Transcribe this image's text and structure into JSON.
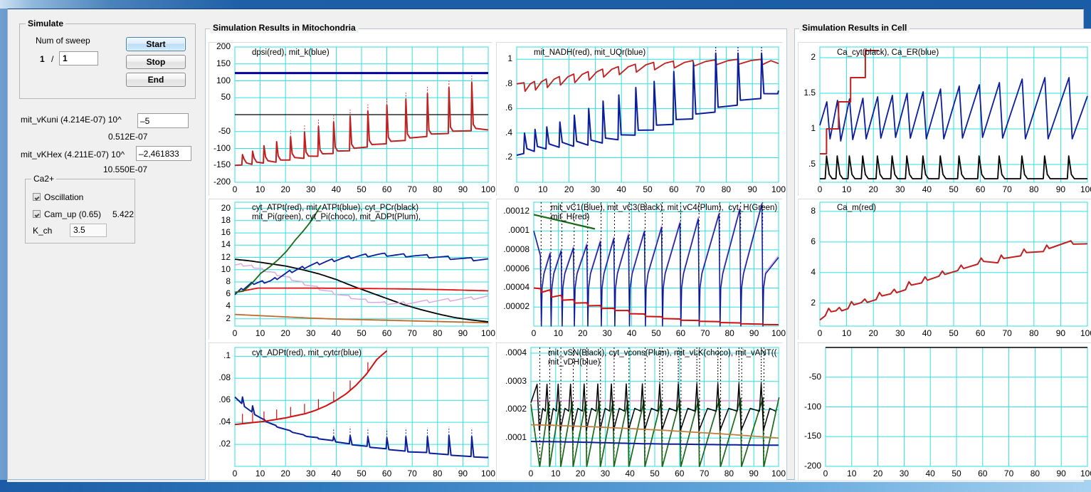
{
  "window": {
    "title": ""
  },
  "simulate": {
    "group_label": "Simulate",
    "sweep_label": "Num of sweep",
    "sweep_current": "1",
    "sweep_separator": "/",
    "sweep_total": "1",
    "start_label": "Start",
    "stop_label": "Stop",
    "end_label": "End"
  },
  "params": {
    "vkuni_label": "mit_vKuni (4.214E-07)  10^",
    "vkuni_exponent": "–5",
    "vkuni_result": "0.512E-07",
    "vkhex_label": "mit_vKHex (4.211E-07)  10^",
    "vkhex_exponent": "–2,461833",
    "vkhex_result": "10.550E-07"
  },
  "ca2plus": {
    "group_label": "Ca2+",
    "oscillation_label": "Oscillation",
    "oscillation_checked": true,
    "camup_label": "Cam_up (0.65)",
    "camup_checked": true,
    "camup_value": "5.422",
    "kch_label": "K_ch",
    "kch_value": "3.5"
  },
  "panels": {
    "mitochondria_title": "Simulation Results in Mitochondria",
    "cell_title": "Simulation Results in Cell"
  },
  "chart_data": [
    {
      "id": "mito-dpsi",
      "type": "line",
      "title": "dpsi(red), mit_k(blue)",
      "legend": "dpsi(red), mit_k(blue)",
      "xlabel": "",
      "ylabel": "",
      "xlim": [
        0,
        100
      ],
      "ylim": [
        -200,
        200
      ],
      "xticks": [
        0,
        10,
        20,
        30,
        40,
        50,
        60,
        70,
        80,
        90,
        100
      ],
      "yticks": [
        200,
        150,
        100,
        50,
        -50,
        -100,
        -150,
        -200
      ],
      "ytick_labels": [
        "200",
        "150",
        "100",
        "50",
        "-50",
        "-100",
        "-150",
        "-200"
      ],
      "grid": true,
      "series": [
        {
          "name": "dpsi",
          "color": "#d02020",
          "description": "sawtooth bursts rising from -150 baseline to -45; spike peaks grow 2 -> 100",
          "baseline": [
            -150,
            -148,
            -143,
            -140,
            -132,
            -128,
            -120,
            -112,
            -105,
            -95,
            -88,
            -80,
            -72,
            -64,
            -58,
            -52,
            -47,
            -45
          ],
          "spike_peaks": [
            -118,
            -108,
            -92,
            -80,
            -66,
            -52,
            -35,
            -22,
            -5,
            10,
            28,
            45,
            62,
            80,
            95
          ],
          "spike_times": [
            3,
            7,
            11.5,
            16.5,
            22,
            27.5,
            33,
            39,
            45.5,
            52.5,
            60,
            67.5,
            76,
            84.5,
            93.5
          ]
        },
        {
          "name": "mit_k",
          "color": "#0000a0",
          "description": "flat horizontal line at 123",
          "constant": 123
        },
        {
          "name": "zero-axis",
          "color": "#000000",
          "constant": 0
        }
      ]
    },
    {
      "id": "mito-nadh",
      "type": "line",
      "title": "mit_NADH(red), mit_UQr(blue)",
      "legend": "mit_NADH(red), mit_UQr(blue)",
      "xlim": [
        0,
        100
      ],
      "ylim": [
        0,
        1.1
      ],
      "xticks": [
        0,
        10,
        20,
        30,
        40,
        50,
        60,
        70,
        80,
        90,
        100
      ],
      "yticks": [
        1,
        0.8,
        0.6,
        0.4,
        0.2
      ],
      "ytick_labels": [
        "1",
        ".8",
        ".6",
        ".4",
        ".2"
      ],
      "grid": true,
      "series": [
        {
          "name": "mit_NADH",
          "color": "#c02020",
          "description": "rising saw from 0.80 to ~0.98 with downward notches at each burst",
          "upper": [
            0.81,
            0.82,
            0.84,
            0.86,
            0.88,
            0.9,
            0.92,
            0.94,
            0.96,
            0.975,
            0.985,
            0.99,
            0.995,
            1.0,
            1.0
          ],
          "lower": [
            0.74,
            0.75,
            0.77,
            0.79,
            0.81,
            0.83,
            0.855,
            0.875,
            0.895,
            0.915,
            0.93,
            0.945,
            0.955,
            0.96,
            0.955
          ]
        },
        {
          "name": "mit_UQr",
          "color": "#0a1e9b",
          "description": "rising saw from 0.22 baseline to 0.70; peaks grow 0.40 -> 1.05",
          "baseline": [
            0.22,
            0.25,
            0.28,
            0.29,
            0.3,
            0.32,
            0.35,
            0.39,
            0.43,
            0.47,
            0.51,
            0.55,
            0.6,
            0.64,
            0.68,
            0.72
          ],
          "peaks": [
            0.4,
            0.43,
            0.45,
            0.49,
            0.545,
            0.6,
            0.66,
            0.71,
            0.77,
            0.82,
            0.9,
            0.97,
            1.05,
            1.05,
            1.05
          ]
        }
      ]
    },
    {
      "id": "cell-cacyt",
      "type": "line",
      "title": "Ca_cyt(black), Ca_ER(blue)",
      "legend": "Ca_cyt(black), Ca_ER(blue)",
      "xlim": [
        0,
        100
      ],
      "ylim": [
        0.25,
        2.15
      ],
      "xticks": [
        0,
        10,
        20,
        30,
        40,
        50,
        60,
        70,
        80,
        90,
        100
      ],
      "yticks": [
        2,
        1.5,
        1,
        0.5
      ],
      "ytick_labels": [
        "2",
        "1.5",
        "1",
        ".5"
      ],
      "grid": true,
      "series": [
        {
          "name": "Ca_cyt",
          "color": "#000000",
          "description": "narrow periodic spikes from 0.30 baseline to 0.62, period ~7",
          "baseline": 0.3,
          "peak": 0.62
        },
        {
          "name": "Ca_ER",
          "color": "#0a1e9b",
          "description": "ramp sawtooth rising 0.85 -> peak then sharp drop; peaks grow 1.38 -> 1.72",
          "troughs": [
            0.86,
            0.83,
            0.85,
            0.86,
            0.87,
            0.88,
            0.87,
            0.86,
            0.86,
            0.87,
            0.88,
            0.87,
            0.86,
            0.86
          ],
          "peaks": [
            1.38,
            1.4,
            1.42,
            1.43,
            1.45,
            1.47,
            1.5,
            1.52,
            1.56,
            1.6,
            1.62,
            1.65,
            1.7,
            1.72
          ]
        },
        {
          "name": "Ca_m-overlay",
          "color": "#c02020",
          "description": "red staircase only over first 22 time units rising 0.65 -> 2.1",
          "steps": [
            0.65,
            1.0,
            1.0,
            1.38,
            1.38,
            1.72,
            1.72,
            2.05,
            2.1
          ]
        }
      ]
    },
    {
      "id": "mito-atp",
      "type": "line",
      "title": "cyt_ATPt(red), mit_ATPt(blue), cyt_PCr(black)\nmit_Pi(green), cyt_Pi(choco), mit_ADPt(Plum),",
      "legend_line1": "cyt_ATPt(red), mit_ATPt(blue), cyt_PCr(black)",
      "legend_line2": "mit_Pi(green), cyt_Pi(choco), mit_ADPt(Plum),",
      "xlim": [
        0,
        100
      ],
      "ylim": [
        0.8,
        21
      ],
      "xticks": [
        0,
        10,
        20,
        30,
        40,
        50,
        60,
        70,
        80,
        90,
        100
      ],
      "yticks": [
        20,
        18,
        16,
        14,
        12,
        10,
        8,
        6,
        4,
        2
      ],
      "ytick_labels": [
        "20",
        "18",
        "16",
        "14",
        "12",
        "10",
        "8",
        "6",
        "4",
        "2"
      ],
      "grid": true,
      "series": [
        {
          "name": "cyt_ATPt",
          "color": "#e01010",
          "description": "nearly flat at 7.0 slowly drifting to 6.5",
          "values": [
            6.3,
            7.0,
            7.0,
            7.0,
            6.98,
            6.95,
            6.92,
            6.88,
            6.82,
            6.75,
            6.65,
            6.55
          ]
        },
        {
          "name": "mit_ATPt",
          "color": "#0a1e9b",
          "description": "rises 6.2 -> 12.5 by t=45 with sawtooth notches, then decays to 11.4",
          "values": [
            6.2,
            7.8,
            8.2,
            9.6,
            10.6,
            11.3,
            11.9,
            12.3,
            12.5,
            12.4,
            12.3,
            12.1,
            11.9,
            11.7,
            11.5
          ]
        },
        {
          "name": "cyt_PCr",
          "color": "#000000",
          "description": "monotone decay 11.7 -> 1.5 in steps",
          "values": [
            11.7,
            11.4,
            11.0,
            10.6,
            10.0,
            9.3,
            8.4,
            7.3,
            6.3,
            5.3,
            4.3,
            3.5,
            2.8,
            2.2,
            1.8,
            1.5
          ]
        },
        {
          "name": "mit_Pi",
          "color": "#1a6a1a",
          "description": "steep staircase rise 6.3 -> offscreen above 20 by t=32",
          "values": [
            6.3,
            6.5,
            7.8,
            9.4,
            10.4,
            11.6,
            13.0,
            14.8,
            16.4,
            18.2,
            20.5
          ]
        },
        {
          "name": "cyt_Pi",
          "color": "#c06a2a",
          "description": "slow decay 2.7 -> 1.3",
          "values": [
            2.7,
            2.5,
            2.3,
            2.1,
            1.95,
            1.85,
            1.75,
            1.65,
            1.55,
            1.45,
            1.35
          ]
        },
        {
          "name": "mit_ADPt",
          "color": "#dda8dd",
          "description": "falls 11.0 -> 4.5 by t=55, then slowly rises to 5.5 with sawtooth",
          "values": [
            11.0,
            10.5,
            9.6,
            8.6,
            7.6,
            6.6,
            5.8,
            5.1,
            4.6,
            4.5,
            4.7,
            4.9,
            5.1,
            5.3,
            5.5
          ]
        }
      ]
    },
    {
      "id": "mito-flux",
      "type": "line",
      "title": "mit_vC1(Blue), mit_vC3(Black), mit_vC4(Plum),  cyt_H(Green)\nmit_H(red)",
      "legend_line1": "mit_vC1(Blue), mit_vC3(Black), mit_vC4(Plum),  cyt_H(Green)",
      "legend_line2": "mit_H(red)",
      "xlim": [
        0,
        100
      ],
      "ylim": [
        0,
        0.00013
      ],
      "xticks": [
        0,
        10,
        20,
        30,
        40,
        50,
        60,
        70,
        80,
        90,
        100
      ],
      "yticks": [
        0.00012,
        0.0001,
        8e-05,
        6e-05,
        4e-05,
        2e-05
      ],
      "ytick_labels": [
        ".00012",
        ".0001",
        ".00008",
        ".00006",
        ".00004",
        ".00002"
      ],
      "grid": true,
      "series": [
        {
          "name": "mit_vC1",
          "color": "#0a1e9b",
          "description": "sawtooth 0.00004 -> 0.00008 repeating, drops to near 0 at each spike",
          "troughs": 4e-05,
          "peaks": 8e-05
        },
        {
          "name": "mit_vC3",
          "color": "#000000",
          "description": "dotted vertical spike markers at each burst time"
        },
        {
          "name": "mit_vC4",
          "color": "#dda8dd",
          "description": "overlay sawtooth nearly coincident with mit_vC1"
        },
        {
          "name": "cyt_H",
          "color": "#1a6a1a",
          "description": "decaying curve above 0.0001 only for t<25, leaves plot at top"
        },
        {
          "name": "mit_H",
          "color": "#d01010",
          "description": "staircase decay 0.00004 -> near 0 by t=60",
          "values": [
            4e-05,
            3.85e-05,
            3e-05,
            2.55e-05,
            2.2e-05,
            1.85e-05,
            1.6e-05,
            1.2e-05,
            9.5e-06,
            7.5e-06,
            6e-06,
            5e-06,
            4e-06,
            3e-06,
            2e-06,
            1.5e-06
          ]
        }
      ]
    },
    {
      "id": "cell-cam",
      "type": "line",
      "title": "Ca_m(red)",
      "legend": "Ca_m(red)",
      "xlim": [
        0,
        100
      ],
      "ylim": [
        0.5,
        8.6
      ],
      "xticks": [
        0,
        10,
        20,
        30,
        40,
        50,
        60,
        70,
        80,
        90,
        100
      ],
      "yticks": [
        8,
        6,
        4,
        2
      ],
      "ytick_labels": [
        "8",
        "6",
        "4",
        "2"
      ],
      "grid": true,
      "series": [
        {
          "name": "Ca_m",
          "color": "#c02020",
          "description": "monotone staircase 0.9 -> 5.9, one step per Ca burst",
          "values": [
            0.9,
            1.2,
            1.5,
            1.5,
            1.8,
            2.05,
            2.05,
            2.35,
            2.6,
            2.65,
            2.9,
            3.25,
            3.35,
            3.6,
            3.85,
            3.9,
            4.2,
            4.3,
            4.55,
            4.75,
            4.55,
            4.9,
            5.05,
            5.1,
            5.4,
            5.25,
            5.6,
            5.5,
            6.0,
            5.85,
            5.85
          ]
        }
      ]
    },
    {
      "id": "mito-adp",
      "type": "line",
      "title": "cyt_ADPt(red), mit_cytcr(blue)",
      "legend": "cyt_ADPt(red), mit_cytcr(blue)",
      "xlim": [
        0,
        100
      ],
      "ylim": [
        0,
        0.108
      ],
      "xticks": [
        0,
        10,
        20,
        30,
        40,
        50,
        60,
        70,
        80,
        90,
        100
      ],
      "yticks": [
        0.1,
        0.08,
        0.06,
        0.04,
        0.02
      ],
      "ytick_labels": [
        ".1",
        ".08",
        ".06",
        ".04",
        ".02"
      ],
      "grid": true,
      "series": [
        {
          "name": "cyt_ADPt",
          "color": "#d01010",
          "description": "rises 0.038 -> 0.105 by t=60 then stops (curve ends at t=60)",
          "values": [
            0.038,
            0.039,
            0.04,
            0.041,
            0.0425,
            0.044,
            0.046,
            0.048,
            0.051,
            0.055,
            0.06,
            0.066,
            0.074,
            0.084,
            0.097,
            0.105
          ]
        },
        {
          "name": "mit_cytcr",
          "color": "#0a1e9b",
          "description": "sawtooth decaying 0.063 -> 0.008 baseline; spikes at each burst",
          "baseline": [
            0.063,
            0.05,
            0.04,
            0.034,
            0.029,
            0.026,
            0.023,
            0.02,
            0.018,
            0.016,
            0.014,
            0.013,
            0.012,
            0.01,
            0.009,
            0.008
          ],
          "peaks": [
            0.063,
            0.055,
            0.043,
            0.036,
            0.032,
            0.028,
            0.025,
            0.027,
            0.028,
            0.027,
            0.026,
            0.027,
            0.027,
            0.028,
            0.027
          ]
        }
      ]
    },
    {
      "id": "mito-vsn",
      "type": "line",
      "title": "mit_vSN(Black), cyt_vcons(Plum), mit_vLK(choco), mit_vANT(\nmit_vDH(blue)",
      "legend_line1": "mit_vSN(Black), cyt_vcons(Plum), mit_vLK(choco), mit_vANT((",
      "legend_line2": "mit_vDH(blue)",
      "xlim": [
        0,
        100
      ],
      "ylim": [
        0,
        0.00042
      ],
      "xticks": [
        0,
        10,
        20,
        30,
        40,
        50,
        60,
        70,
        80,
        90,
        100
      ],
      "yticks": [
        0.0004,
        0.0003,
        0.0002,
        0.0001
      ],
      "ytick_labels": [
        ".0004",
        ".0003",
        ".0002",
        ".0001"
      ],
      "grid": true,
      "series": [
        {
          "name": "mit_vSN",
          "color": "#000000",
          "description": "repeating spikes from 0.00013 trough to 0.00030 peak, peaks slowly decline then rise",
          "troughs": 0.00013,
          "peaks": 0.0003
        },
        {
          "name": "cyt_vcons",
          "color": "#dda8dd",
          "description": "flat horizontal line at 0.000232",
          "constant": 0.000232
        },
        {
          "name": "mit_vLK",
          "color": "#c08040",
          "description": "slow linear decay 0.000147 -> 0.000100",
          "values": [
            0.000147,
            0.000145,
            0.000142,
            0.000139,
            0.000135,
            0.000131,
            0.000127,
            0.000122,
            0.000117,
            0.000112,
            0.000106,
            0.0001
          ]
        },
        {
          "name": "mit_vANT",
          "color": "#1a6a1a",
          "description": "sawtooth ramps from 0 up to 0.00022-0.00025 then vertical drop each burst",
          "troughs": 0.0,
          "peaks": 0.00023
        },
        {
          "name": "mit_vDH",
          "color": "#0a1e9b",
          "description": "slow decay 0.000088 -> 0.000075 with small notches",
          "values": [
            8.8e-05,
            8.7e-05,
            8.6e-05,
            8.4e-05,
            8.2e-05,
            8e-05,
            7.9e-05,
            7.8e-05,
            7.7e-05,
            7.6e-05,
            7.5e-05,
            7.5e-05
          ]
        }
      ]
    },
    {
      "id": "cell-empty",
      "type": "line",
      "title": "",
      "legend": "",
      "xlim": [
        0,
        100
      ],
      "ylim": [
        -200,
        0
      ],
      "xticks": [
        0,
        10,
        20,
        30,
        40,
        50,
        60,
        70,
        80,
        90,
        100
      ],
      "yticks": [
        -50,
        -100,
        -150,
        -200
      ],
      "ytick_labels": [
        "-50",
        "-100",
        "-150",
        "-200"
      ],
      "grid": true,
      "series": [
        {
          "name": "top-axis",
          "color": "#000000",
          "description": "single flat black line along the top border at y=0",
          "constant": 0
        }
      ]
    }
  ],
  "colors": {
    "grid": "#2fe0e0",
    "red": "#d01010",
    "blue": "#0a1e9b",
    "black": "#000000",
    "green": "#1a6a1a",
    "choco": "#c08040",
    "plum": "#dda8dd",
    "panel_bg": "#f0f0f0",
    "plot_bg": "#ffffff",
    "window_blue": "#1b5ca6"
  }
}
